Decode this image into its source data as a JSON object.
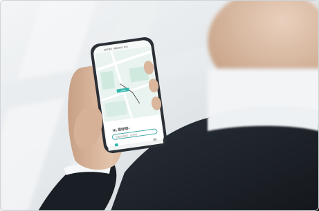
{
  "scene": {
    "subject": "hand-holding-smartphone",
    "colors": {
      "background_light": "#eef1f3",
      "background_mid": "#d6dbdf",
      "suit": "#1d232b",
      "shirt_cuff": "#f4f6f8",
      "skin": "#d7b59b",
      "phone_frame": "#2b2f36",
      "map_green": "#cfe9df",
      "map_road": "#ffffff",
      "accent_teal": "#35b7ad"
    }
  },
  "phone_screen": {
    "status_left": "9:41",
    "status_right": "5G",
    "top_notice": "服務通告 | 乘客須知 | 安全",
    "map_pin_label": "上車點",
    "greeting": "Hi, 您好呀~",
    "search_placeholder": "您欲去哪裡？ 目的地",
    "tabs": [
      {
        "icon": "car-icon",
        "active": true
      },
      {
        "icon": "profile-icon",
        "active": false
      }
    ]
  }
}
